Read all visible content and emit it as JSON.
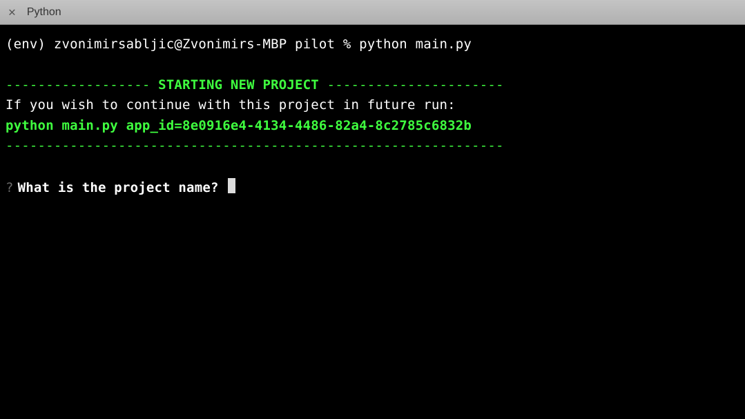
{
  "window": {
    "title": "Python"
  },
  "terminal": {
    "prompt_line": "(env) zvonimirsabljic@Zvonimirs-MBP pilot % python main.py",
    "header_dashes_left": "------------------",
    "header_text": " STARTING NEW PROJECT ",
    "header_dashes_right": "----------------------",
    "continue_msg": "If you wish to continue with this project in future run:",
    "continue_cmd": "python main.py app_id=8e0916e4-4134-4486-82a4-8c2785c6832b",
    "bottom_dashes": "--------------------------------------------------------------",
    "question_mark": "?",
    "question": "What is the project name?"
  }
}
